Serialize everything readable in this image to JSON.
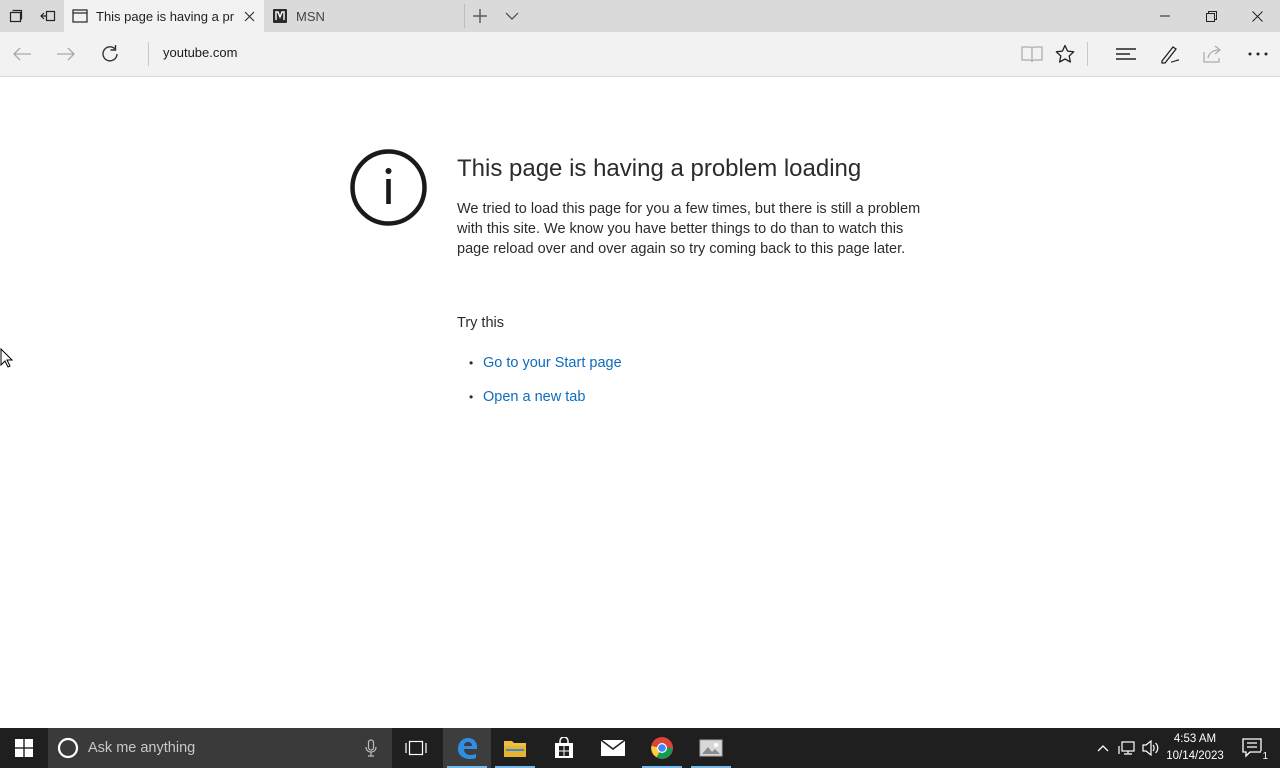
{
  "browser": {
    "tabs": [
      {
        "title": "This page is having a pr",
        "active": true,
        "icon": "page-icon"
      },
      {
        "title": "MSN",
        "active": false,
        "icon": "msn-icon"
      }
    ],
    "address": "youtube.com"
  },
  "error_page": {
    "title": "This page is having a problem loading",
    "body": "We tried to load this page for you a few times, but there is still a problem with this site. We know you have better things to do than to watch this page reload over and over again so try coming back to this page later.",
    "try_this": "Try this",
    "suggestions": [
      "Go to your Start page",
      "Open a new tab"
    ],
    "bullet": "•"
  },
  "taskbar": {
    "search_placeholder": "Ask me anything",
    "apps": [
      "edge-icon",
      "file-explorer-icon",
      "store-icon",
      "mail-icon",
      "chrome-icon",
      "photos-icon"
    ],
    "time": "4:53 AM",
    "date": "10/14/2023",
    "notification_count": "1"
  },
  "colors": {
    "link": "#0f6cbd",
    "taskbar": "#1f1f1f",
    "tab_bar": "#dadada",
    "active_tab": "#f2f2f2"
  }
}
